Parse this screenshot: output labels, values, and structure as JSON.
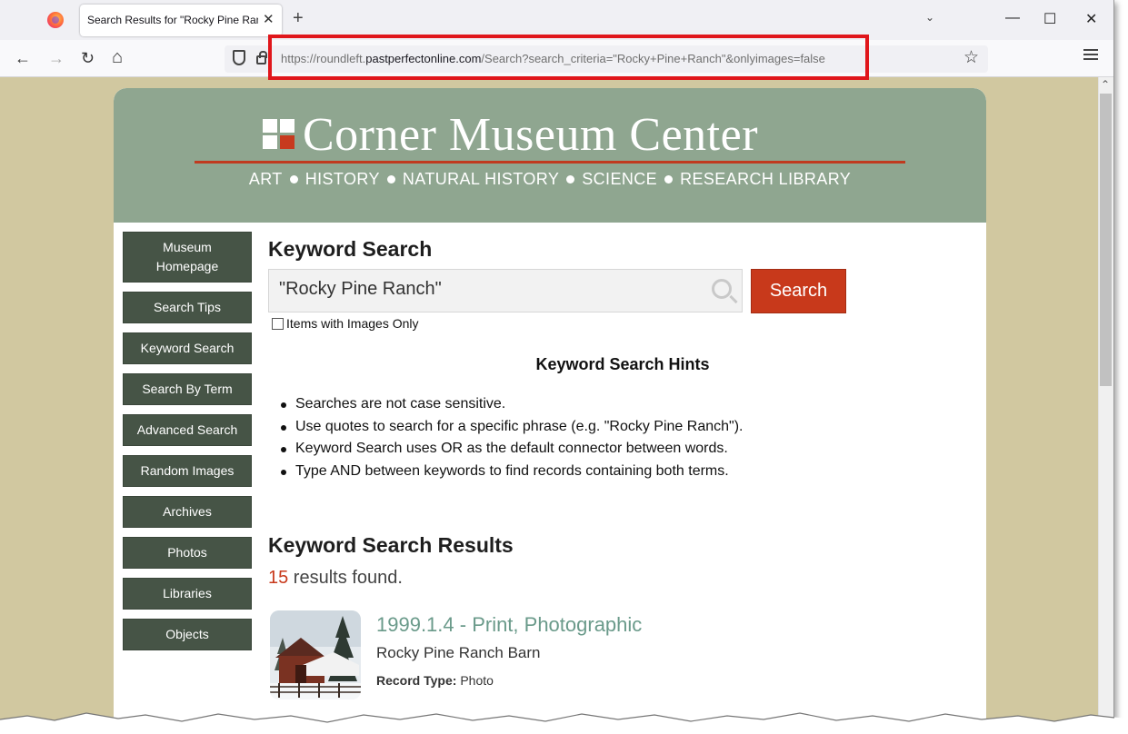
{
  "browser": {
    "tab_title": "Search Results for \"Rocky Pine Ranch\"",
    "tab_close": "✕",
    "new_tab": "+",
    "tab_list": "⌄",
    "minimize": "—",
    "maximize": "☐",
    "close": "✕",
    "back": "←",
    "forward": "→",
    "reload": "↻",
    "home": "⌂",
    "url_prefix": "https://roundleft.",
    "url_domain": "pastperfectonline.com",
    "url_path": "/Search?search_criteria=\"Rocky+Pine+Ranch\"&onlyimages=false",
    "bookmark": "☆",
    "scroll_up": "⌃"
  },
  "header": {
    "site_title": "Corner Museum Center",
    "nav": [
      "ART",
      "HISTORY",
      "NATURAL HISTORY",
      "SCIENCE",
      "RESEARCH LIBRARY"
    ]
  },
  "sidebar": {
    "items": [
      {
        "label": "Museum Homepage"
      },
      {
        "label": "Search Tips"
      },
      {
        "label": "Keyword Search"
      },
      {
        "label": "Search By Term"
      },
      {
        "label": "Advanced Search"
      },
      {
        "label": "Random Images"
      },
      {
        "label": "Archives"
      },
      {
        "label": "Photos"
      },
      {
        "label": "Libraries"
      },
      {
        "label": "Objects"
      }
    ]
  },
  "search": {
    "heading": "Keyword Search",
    "value": "\"Rocky Pine Ranch\"",
    "button": "Search",
    "images_only_label": "Items with Images Only",
    "images_only_checked": false
  },
  "hints": {
    "title": "Keyword Search Hints",
    "items": [
      "Searches are not case sensitive.",
      "Use quotes to search for a specific phrase (e.g. \"Rocky Pine Ranch\").",
      "Keyword Search uses OR as the default connector between words.",
      "Type AND between keywords to find records containing both terms."
    ]
  },
  "results": {
    "heading": "Keyword Search Results",
    "count": "15",
    "count_suffix": " results found.",
    "items": [
      {
        "title": "1999.1.4 - Print, Photographic",
        "subtitle": "Rocky Pine Ranch Barn",
        "record_type_label": "Record Type:",
        "record_type": "Photo"
      }
    ]
  },
  "colors": {
    "header_bg": "#8fa690",
    "accent_red": "#c8391b",
    "sidebar_btn": "#465446",
    "page_bg": "#d1c8a0",
    "result_title": "#6a9a8a"
  }
}
